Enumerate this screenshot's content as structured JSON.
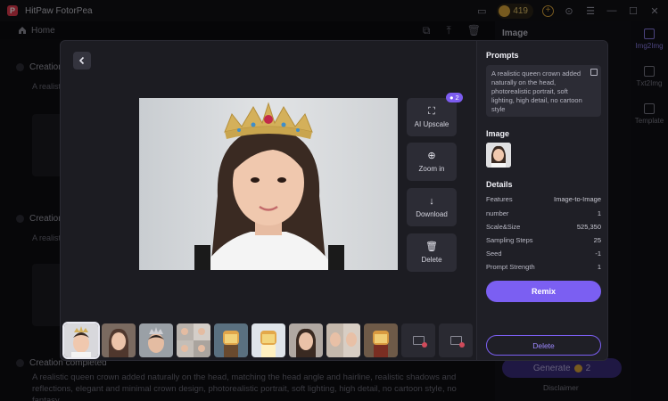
{
  "app": {
    "title": "HitPaw FotorPea"
  },
  "titlebar": {
    "credits": "419"
  },
  "nav": {
    "home_label": "Home"
  },
  "background": {
    "section1_title": "Creation completed",
    "section1_text": "A realistic...",
    "section2_title": "Creation completed",
    "section2_text": "A realistic...",
    "section3_title": "Creation completed",
    "section3_text": "A realistic queen crown added naturally on the head, matching the head angle and hairline, realistic shadows and reflections, elegant and minimal crown design, photorealistic portrait, soft lighting, high detail, no cartoon style, no fantasy"
  },
  "right_panel": {
    "title": "Image",
    "generate_label": "Generate",
    "generate_cost": "2",
    "disclaimer": "Disclaimer"
  },
  "rail": {
    "items": [
      {
        "label": "Img2Img"
      },
      {
        "label": "Txt2Img"
      },
      {
        "label": "Template"
      }
    ]
  },
  "modal": {
    "tools": {
      "upscale_label": "AI Upscale",
      "upscale_badge": "2",
      "zoom_label": "Zoom in",
      "download_label": "Download",
      "delete_label": "Delete"
    },
    "details": {
      "prompts_heading": "Prompts",
      "prompt_text": "A realistic queen crown added naturally on the head, photorealistic portrait, soft lighting, high detail, no cartoon style",
      "image_heading": "Image",
      "details_heading": "Details",
      "rows": [
        {
          "label": "Features",
          "value": "Image-to-Image"
        },
        {
          "label": "number",
          "value": "1"
        },
        {
          "label": "Scale&Size",
          "value": "525,350"
        },
        {
          "label": "Sampling Steps",
          "value": "25"
        },
        {
          "label": "Seed",
          "value": "-1"
        },
        {
          "label": "Prompt Strength",
          "value": "1"
        }
      ],
      "remix_label": "Remix",
      "delete_label": "Delete"
    },
    "colors": {
      "accent": "#7b5ff2",
      "badge": "#7c5cf0"
    }
  }
}
